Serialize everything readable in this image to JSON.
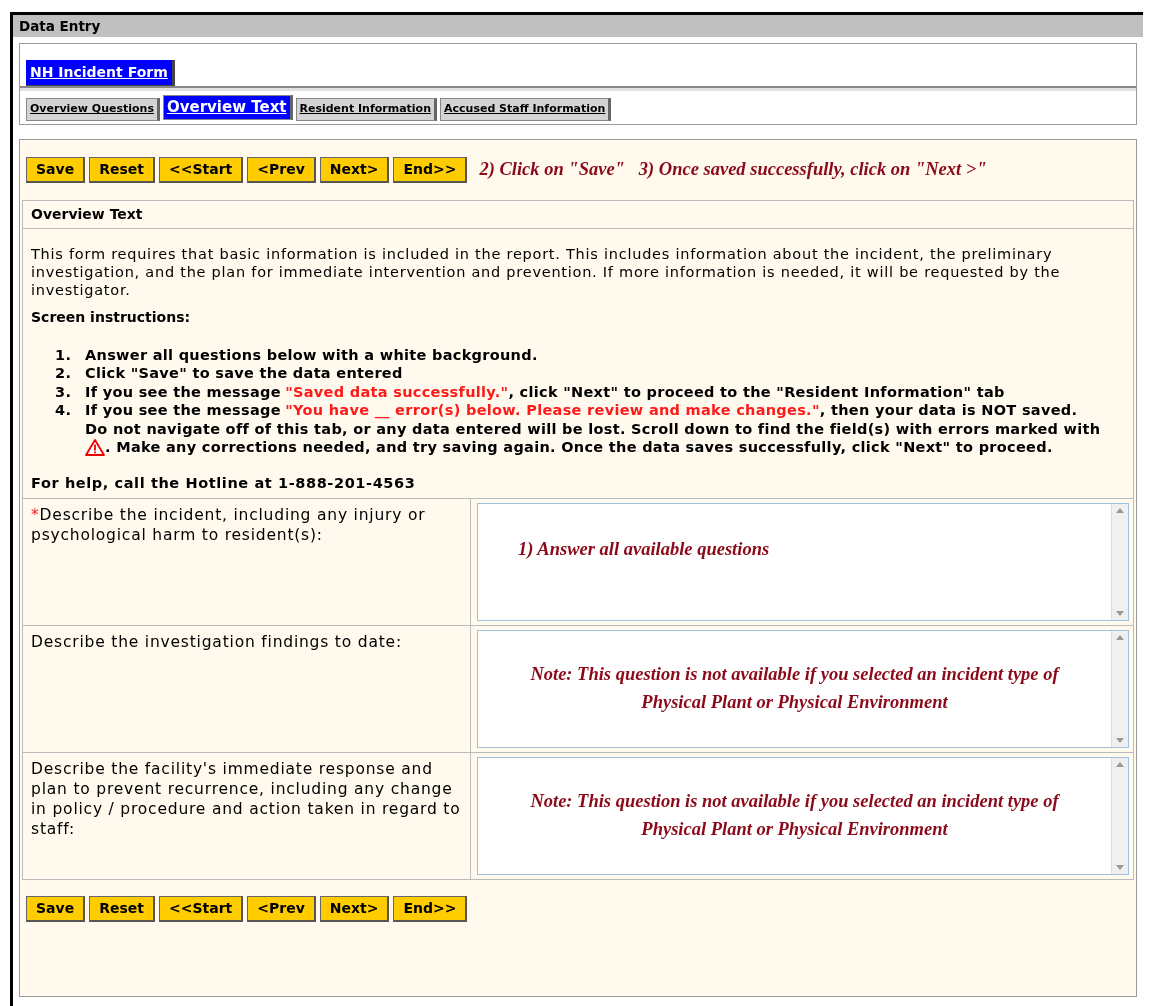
{
  "panel_title": "Data Entry",
  "form_tabs": [
    {
      "label": "NH Incident Form",
      "selected": true
    }
  ],
  "section_tabs": [
    {
      "label": "Overview Questions",
      "selected": false
    },
    {
      "label": "Overview Text",
      "selected": true
    },
    {
      "label": "Resident Information",
      "selected": false
    },
    {
      "label": "Accused Staff Information",
      "selected": false
    }
  ],
  "top_buttons": [
    "Save",
    "Reset",
    "<<Start",
    "<Prev",
    "Next>",
    "End>>"
  ],
  "top_annotation": "2) Click on \"Save\"   3) Once saved successfully, click on \"Next >\"",
  "section_title": "Overview Text",
  "intro": "This form requires that basic information is included in the report. This includes information about the incident, the preliminary investigation, and the plan for immediate intervention and prevention. If more information is needed, it will be requested by the investigator.",
  "instructions_heading": "Screen instructions:",
  "instructions": [
    {
      "number": "1.",
      "lines": [
        [
          {
            "text": "Answer all questions below with a white background.",
            "alert": false
          }
        ]
      ]
    },
    {
      "number": "2.",
      "lines": [
        [
          {
            "text": "Click \"Save\" to save the data entered",
            "alert": false
          }
        ]
      ]
    },
    {
      "number": "3.",
      "lines": [
        [
          {
            "text": "If you see the message",
            "alert": false
          },
          {
            "text": "\"Saved data successfully.\"",
            "alert": true
          },
          {
            "text": ", click \"Next\" to proceed to the \"Resident Information\" tab",
            "alert": false
          }
        ]
      ]
    },
    {
      "number": "4.",
      "lines": [
        [
          {
            "text": "If you see the message",
            "alert": false
          },
          {
            "text": "\"You have __ error(s) below. Please review and make changes.\"",
            "alert": true
          },
          {
            "text": ", then your data is NOT saved.",
            "alert": false
          }
        ],
        [
          {
            "text": "Do not navigate off of this tab, or any data entered will be lost. Scroll down to find the field(s) with errors marked with",
            "alert": false
          }
        ]
      ],
      "after_icon": ". Make any corrections needed, and try saving again. Once the data saves successfully, click \"Next\" to proceed."
    }
  ],
  "help_text": "For help, call the Hotline at 1-888-201-4563",
  "questions": [
    {
      "required_mark": "*",
      "label": "Describe the incident, including any injury or psychological harm to resident(s):",
      "annotation": "1) Answer all available questions",
      "kind": "left"
    },
    {
      "label": "Describe the investigation findings to date:",
      "annotation": "Note: This question is not available if you selected an incident type of Physical Plant or Physical Environment",
      "kind": "center"
    },
    {
      "label": "Describe the facility's immediate response and plan to prevent recurrence, including any change in policy / procedure and action taken in regard to staff:",
      "annotation": "Note: This question is not available if you selected an incident type of Physical Plant or Physical Environment",
      "kind": "center"
    }
  ],
  "bottom_buttons": [
    "Save",
    "Reset",
    "<<Start",
    "<Prev",
    "Next>",
    "End>>"
  ]
}
